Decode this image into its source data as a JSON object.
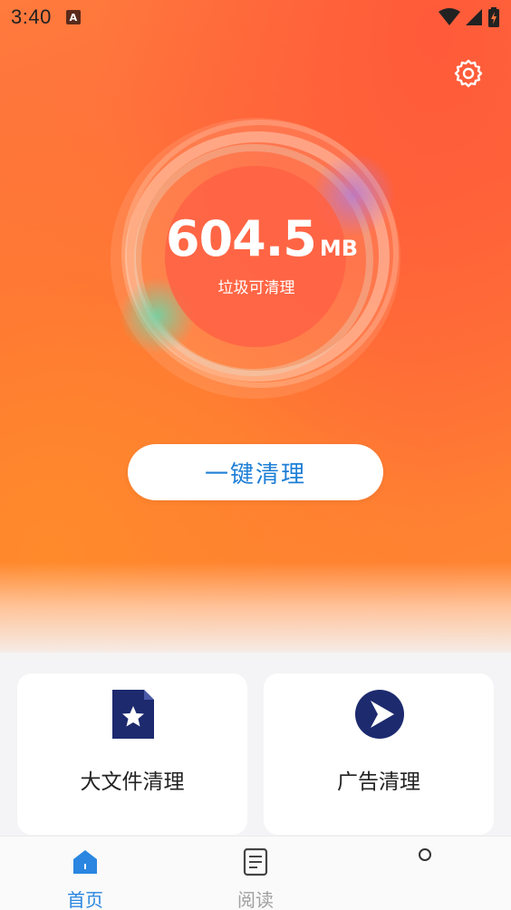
{
  "status_bar": {
    "time": "3:40",
    "app_icon_letter": "A"
  },
  "storage": {
    "size_value": "604.5",
    "size_unit": "MB",
    "label": "垃圾可清理"
  },
  "clean_button": {
    "label": "一键清理"
  },
  "features": [
    {
      "label": "大文件清理",
      "icon": "file-star-icon"
    },
    {
      "label": "广告清理",
      "icon": "play-arrow-icon"
    }
  ],
  "bottom_nav": {
    "items": [
      {
        "label": "首页",
        "icon": "home-icon",
        "active": true
      },
      {
        "label": "阅读",
        "icon": "document-icon",
        "active": false
      }
    ]
  },
  "colors": {
    "accent_blue": "#1e7fd6",
    "icon_navy": "#1d2a6e",
    "hero_orange": "#ff6b39"
  }
}
